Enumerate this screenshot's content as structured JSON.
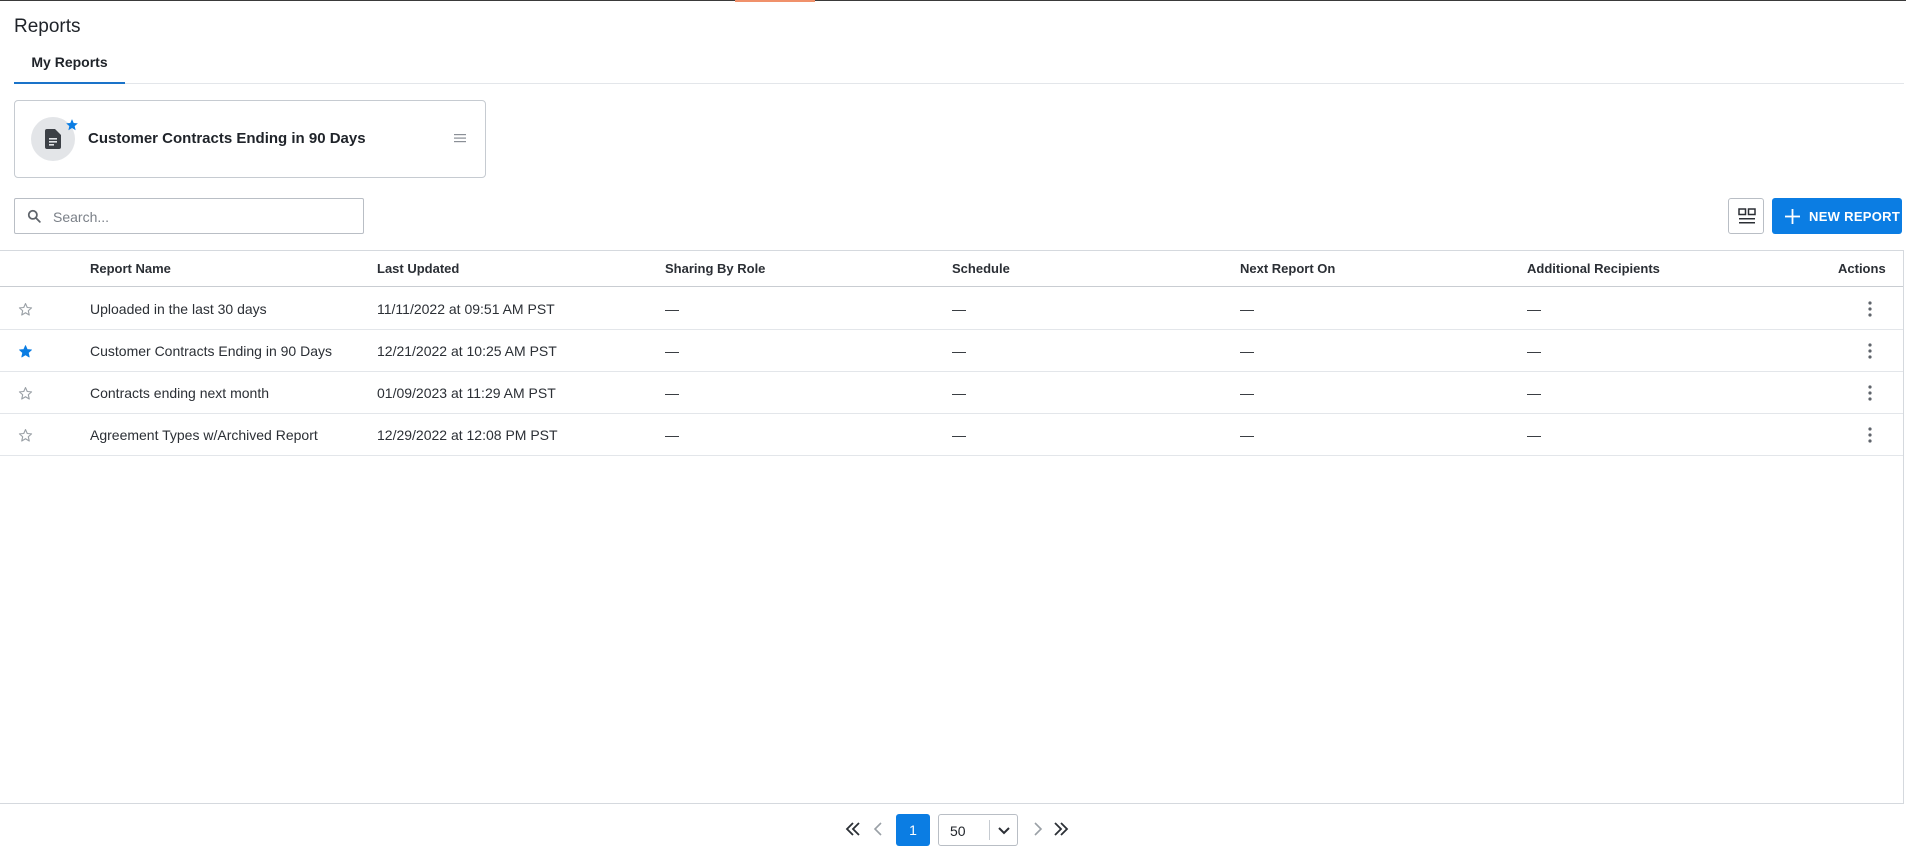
{
  "page": {
    "title": "Reports"
  },
  "tabs": [
    {
      "label": "My Reports",
      "active": true
    }
  ],
  "featured_card": {
    "title": "Customer Contracts Ending in 90 Days",
    "starred": true
  },
  "search": {
    "placeholder": "Search...",
    "value": ""
  },
  "toolbar": {
    "new_report_label": "NEW REPORT"
  },
  "table": {
    "columns": [
      "Report Name",
      "Last Updated",
      "Sharing By Role",
      "Schedule",
      "Next Report On",
      "Additional Recipients",
      "Actions"
    ],
    "rows": [
      {
        "starred": false,
        "name": "Uploaded in the last 30 days",
        "last_updated": "11/11/2022 at 09:51 AM PST",
        "sharing": "—",
        "schedule": "—",
        "next_report": "—",
        "recipients": "—"
      },
      {
        "starred": true,
        "name": "Customer Contracts Ending in 90 Days",
        "last_updated": "12/21/2022 at 10:25 AM PST",
        "sharing": "—",
        "schedule": "—",
        "next_report": "—",
        "recipients": "—"
      },
      {
        "starred": false,
        "name": "Contracts ending next month",
        "last_updated": "01/09/2023 at 11:29 AM PST",
        "sharing": "—",
        "schedule": "—",
        "next_report": "—",
        "recipients": "—"
      },
      {
        "starred": false,
        "name": "Agreement Types w/Archived Report",
        "last_updated": "12/29/2022 at 12:08 PM PST",
        "sharing": "—",
        "schedule": "—",
        "next_report": "—",
        "recipients": "—"
      }
    ]
  },
  "pagination": {
    "current_page": "1",
    "page_size": "50"
  },
  "colors": {
    "accent": "#0b7de3",
    "star_active": "#0b7de3",
    "star_inactive": "#9aa0a6"
  }
}
